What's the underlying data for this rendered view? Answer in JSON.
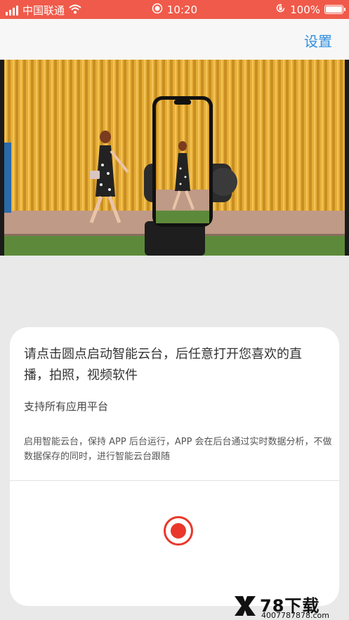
{
  "status": {
    "carrier": "中国联通",
    "time": "10:20",
    "battery_percent": "100%",
    "icons": [
      "signal-icon",
      "wifi-icon",
      "record-indicator-icon",
      "orientation-lock-icon",
      "battery-icon"
    ]
  },
  "header": {
    "settings_label": "设置"
  },
  "hero": {
    "description": "phone on smart gimbal filming a woman walking past a yellow wall"
  },
  "card": {
    "headline": "请点击圆点启动智能云台，后任意打开您喜欢的直播，拍照，视频软件",
    "subheading": "支持所有应用平台",
    "description": "启用智能云台，保持 APP 后台运行，APP 会在后台通过实时数据分析，不做数据保存的同时，进行智能云台跟随"
  },
  "watermark": {
    "brand": "78下载",
    "url": "4007787878.com"
  },
  "colors": {
    "accent": "#f05a4a",
    "link": "#2f8fe0",
    "record": "#e9382b"
  }
}
